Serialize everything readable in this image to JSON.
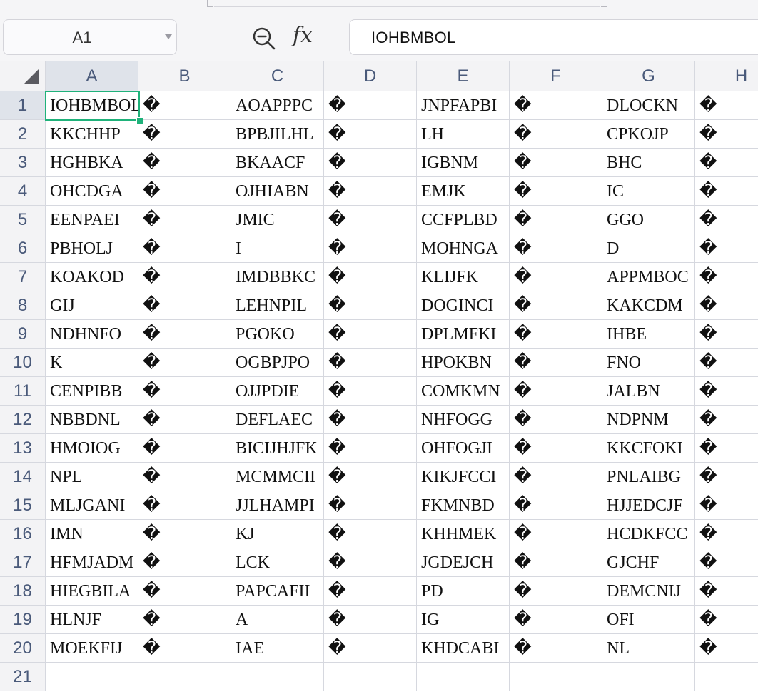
{
  "name_box": {
    "value": "A1"
  },
  "formula_bar": {
    "fx_label": "fx",
    "content": "IOHBMBOL"
  },
  "icons": {
    "zoom": "zoom-out-icon",
    "dropdown": "chevron-down-icon",
    "select_all": "select-all-triangle-icon"
  },
  "colors": {
    "selection": "#1fb27a",
    "header_bg": "#f3f3f5",
    "header_text": "#4a5a7a",
    "gridline": "#d6d8df"
  },
  "selected_cell": "A1",
  "columns": [
    "A",
    "B",
    "C",
    "D",
    "E",
    "F",
    "G",
    "H"
  ],
  "rows": [
    "1",
    "2",
    "3",
    "4",
    "5",
    "6",
    "7",
    "8",
    "9",
    "10",
    "11",
    "12",
    "13",
    "14",
    "15",
    "16",
    "17",
    "18",
    "19",
    "20",
    "21"
  ],
  "cells": [
    [
      "IOHBMBOL",
      "�",
      "AOAPPPC",
      "�",
      "JNPFAPBI",
      "�",
      "DLOCKN",
      "�"
    ],
    [
      "KKCHHP",
      "�",
      "BPBJILHL",
      "�",
      "LH",
      "�",
      "CPKOJP",
      "�"
    ],
    [
      "HGHBKA",
      "�",
      "BKAACF",
      "�",
      "IGBNM",
      "�",
      "BHC",
      "�"
    ],
    [
      "OHCDGA",
      "�",
      "OJHIABN",
      "�",
      "EMJK",
      "�",
      "IC",
      "�"
    ],
    [
      "EENPAEI",
      "�",
      "JMIC",
      "�",
      "CCFPLBD",
      "�",
      "GGO",
      "�"
    ],
    [
      "PBHOLJ",
      "�",
      "I",
      "�",
      "MOHNGA",
      "�",
      "D",
      "�"
    ],
    [
      "KOAKOD",
      "�",
      "IMDBBKC",
      "�",
      "KLIJFK",
      "�",
      "APPMBOC",
      "�"
    ],
    [
      "GIJ",
      "�",
      "LEHNPIL",
      "�",
      "DOGINCI",
      "�",
      "KAKCDM",
      "�"
    ],
    [
      "NDHNFO",
      "�",
      "PGOKO",
      "�",
      "DPLMFKI",
      "�",
      "IHBE",
      "�"
    ],
    [
      "K",
      "�",
      "OGBPJPO",
      "�",
      "HPOKBN",
      "�",
      "FNO",
      "�"
    ],
    [
      "CENPIBB",
      "�",
      "OJJPDIE",
      "�",
      "COMKMN",
      "�",
      "JALBN",
      "�"
    ],
    [
      "NBBDNL",
      "�",
      "DEFLAEC",
      "�",
      "NHFOGG",
      "�",
      "NDPNM",
      "�"
    ],
    [
      "HMOIOG",
      "�",
      "BICIJHJFK",
      "�",
      "OHFOGJI",
      "�",
      "KKCFOKI",
      "�"
    ],
    [
      "NPL",
      "�",
      "MCMMCII",
      "�",
      "KIKJFCCI",
      "�",
      "PNLAIBG",
      "�"
    ],
    [
      "MLJGANI",
      "�",
      "JJLHAMPI",
      "�",
      "FKMNBD",
      "�",
      "HJJEDCJF",
      "�"
    ],
    [
      "IMN",
      "�",
      "KJ",
      "�",
      "KHHMEK",
      "�",
      "HCDKFCC",
      "�"
    ],
    [
      "HFMJADM",
      "�",
      "LCK",
      "�",
      "JGDEJCH",
      "�",
      "GJCHF",
      "�"
    ],
    [
      "HIEGBILA",
      "�",
      "PAPCAFII",
      "�",
      "PD",
      "�",
      "DEMCNIJ",
      "�"
    ],
    [
      "HLNJF",
      "�",
      "A",
      "�",
      "IG",
      "�",
      "OFI",
      "�"
    ],
    [
      "MOEKFIJ",
      "�",
      "IAE",
      "�",
      "KHDCABI",
      "�",
      "NL",
      "�"
    ],
    [
      "",
      "",
      "",
      "",
      "",
      "",
      "",
      ""
    ]
  ]
}
